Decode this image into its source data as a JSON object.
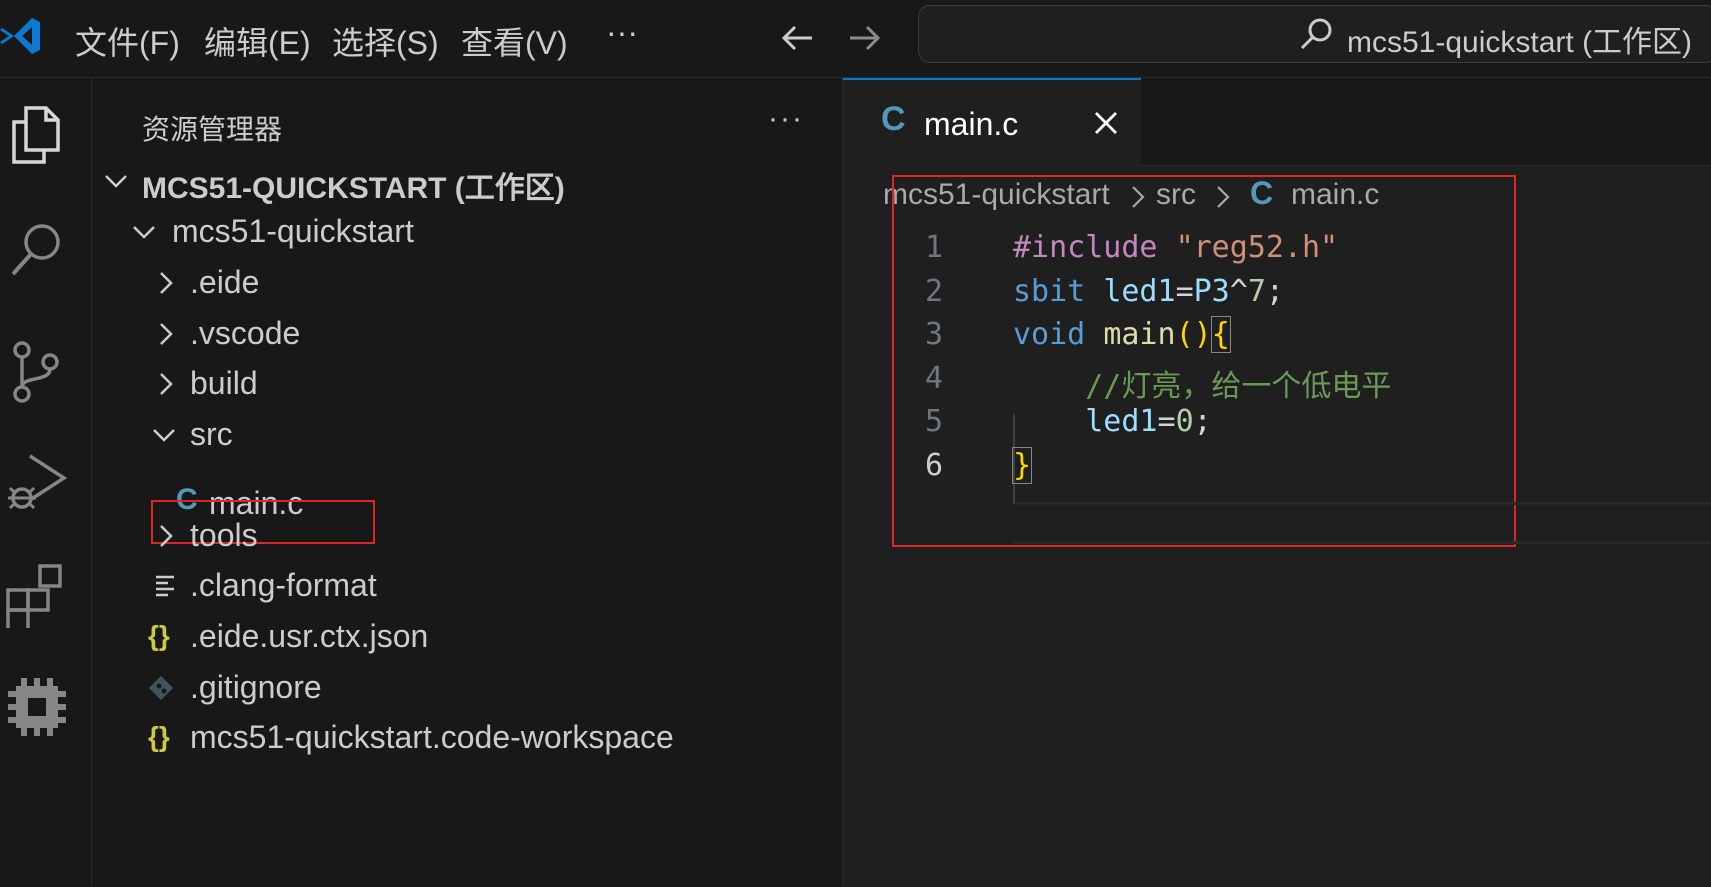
{
  "titlebar": {
    "menu": [
      "文件(F)",
      "编辑(E)",
      "选择(S)",
      "查看(V)",
      "···"
    ],
    "command_center": "mcs51-quickstart (工作区)"
  },
  "activity_bar": {
    "icons": [
      "explorer-icon",
      "search-icon",
      "source-control-icon",
      "run-debug-icon",
      "extensions-icon",
      "eide-chip-icon"
    ]
  },
  "sidebar": {
    "title": "资源管理器",
    "more": "···",
    "workspace": "MCS51-QUICKSTART (工作区)",
    "project": "mcs51-quickstart",
    "items": [
      {
        "label": ".eide",
        "type": "folder",
        "expanded": false
      },
      {
        "label": ".vscode",
        "type": "folder",
        "expanded": false
      },
      {
        "label": "build",
        "type": "folder",
        "expanded": false
      },
      {
        "label": "src",
        "type": "folder",
        "expanded": true
      },
      {
        "label": "main.c",
        "type": "c-file",
        "icon": "C",
        "selected": true
      },
      {
        "label": "tools",
        "type": "folder",
        "expanded": false
      },
      {
        "label": ".clang-format",
        "type": "text-file"
      },
      {
        "label": ".eide.usr.ctx.json",
        "type": "json-file",
        "icon": "{}"
      },
      {
        "label": ".gitignore",
        "type": "git-file"
      },
      {
        "label": "mcs51-quickstart.code-workspace",
        "type": "json-file",
        "icon": "{}"
      }
    ]
  },
  "editor": {
    "tab": {
      "icon": "C",
      "label": "main.c"
    },
    "breadcrumb": [
      "mcs51-quickstart",
      "src",
      "main.c"
    ],
    "breadcrumb_icon": "C",
    "active_line": 6,
    "lines": [
      {
        "no": "1",
        "tokens": [
          {
            "t": "#include",
            "k": "kw"
          },
          {
            "t": " ",
            "k": "punc"
          },
          {
            "t": "\"reg52.h\"",
            "k": "str"
          }
        ]
      },
      {
        "no": "2",
        "tokens": [
          {
            "t": "sbit",
            "k": "type"
          },
          {
            "t": " ",
            "k": "punc"
          },
          {
            "t": "led1",
            "k": "var"
          },
          {
            "t": "=",
            "k": "punc"
          },
          {
            "t": "P3",
            "k": "var"
          },
          {
            "t": "^",
            "k": "punc"
          },
          {
            "t": "7",
            "k": "num"
          },
          {
            "t": ";",
            "k": "punc"
          }
        ]
      },
      {
        "no": "3",
        "tokens": [
          {
            "t": "void",
            "k": "type"
          },
          {
            "t": " ",
            "k": "punc"
          },
          {
            "t": "main",
            "k": "fn"
          },
          {
            "t": "()",
            "k": "brace"
          },
          {
            "t": "{",
            "k": "brace-box"
          }
        ]
      },
      {
        "no": "4",
        "tokens": [
          {
            "t": "    ",
            "k": "punc"
          },
          {
            "t": "//灯亮，给一个低电平",
            "k": "cmt"
          }
        ]
      },
      {
        "no": "5",
        "tokens": [
          {
            "t": "    ",
            "k": "punc"
          },
          {
            "t": "led1",
            "k": "var"
          },
          {
            "t": "=",
            "k": "punc"
          },
          {
            "t": "0",
            "k": "num"
          },
          {
            "t": ";",
            "k": "punc"
          }
        ]
      },
      {
        "no": "6",
        "tokens": [
          {
            "t": "}",
            "k": "brace-box"
          }
        ]
      }
    ]
  },
  "colors": {
    "accent": "#0078d4",
    "highlight_box": "#e02525",
    "c_icon": "#519aba",
    "json_icon": "#cbcb41"
  }
}
